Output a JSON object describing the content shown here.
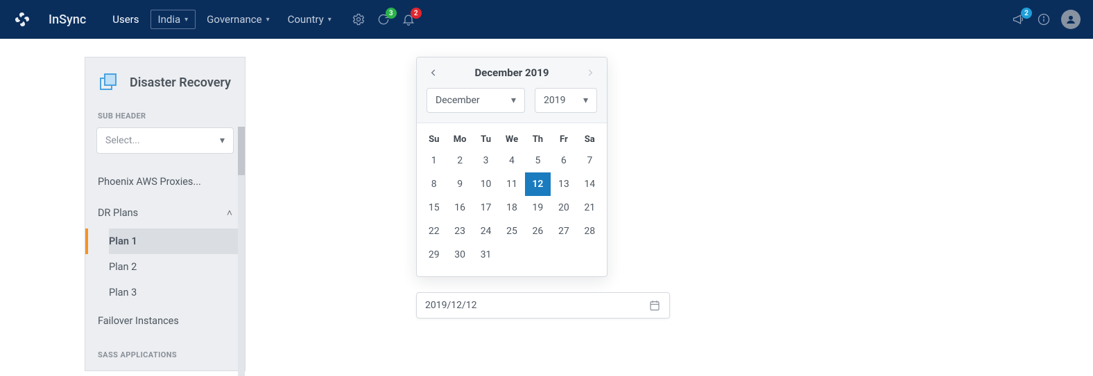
{
  "brand": "InSync",
  "nav": {
    "items": [
      {
        "label": "Users",
        "active": true,
        "boxed": false,
        "caret": false,
        "name": "nav-users"
      },
      {
        "label": "India",
        "active": false,
        "boxed": true,
        "caret": true,
        "name": "nav-india"
      },
      {
        "label": "Governance",
        "active": false,
        "boxed": false,
        "caret": true,
        "name": "nav-governance"
      },
      {
        "label": "Country",
        "active": false,
        "boxed": false,
        "caret": true,
        "name": "nav-country"
      }
    ],
    "badges": {
      "refresh": "3",
      "bell": "2",
      "announce": "2"
    }
  },
  "sidebar": {
    "title": "Disaster Recovery",
    "group1_label": "SUB HEADER",
    "select_placeholder": "Select...",
    "link_proxies": "Phoenix AWS Proxies...",
    "dr_plans_label": "DR Plans",
    "plans": [
      {
        "label": "Plan 1",
        "active": true
      },
      {
        "label": "Plan 2",
        "active": false
      },
      {
        "label": "Plan 3",
        "active": false
      }
    ],
    "link_failover": "Failover Instances",
    "group2_label": "SASS APPLICATIONS"
  },
  "calendar": {
    "title": "December 2019",
    "month_select": "December",
    "year_select": "2019",
    "weekdays": [
      "Su",
      "Mo",
      "Tu",
      "We",
      "Th",
      "Fr",
      "Sa"
    ],
    "weeks": [
      [
        "1",
        "2",
        "3",
        "4",
        "5",
        "6",
        "7"
      ],
      [
        "8",
        "9",
        "10",
        "11",
        "12",
        "13",
        "14"
      ],
      [
        "15",
        "16",
        "17",
        "18",
        "19",
        "20",
        "21"
      ],
      [
        "22",
        "23",
        "24",
        "25",
        "26",
        "27",
        "28"
      ],
      [
        "29",
        "30",
        "31",
        "",
        "",
        "",
        ""
      ]
    ],
    "selected_day": "12"
  },
  "date_input_value": "2019/12/12"
}
